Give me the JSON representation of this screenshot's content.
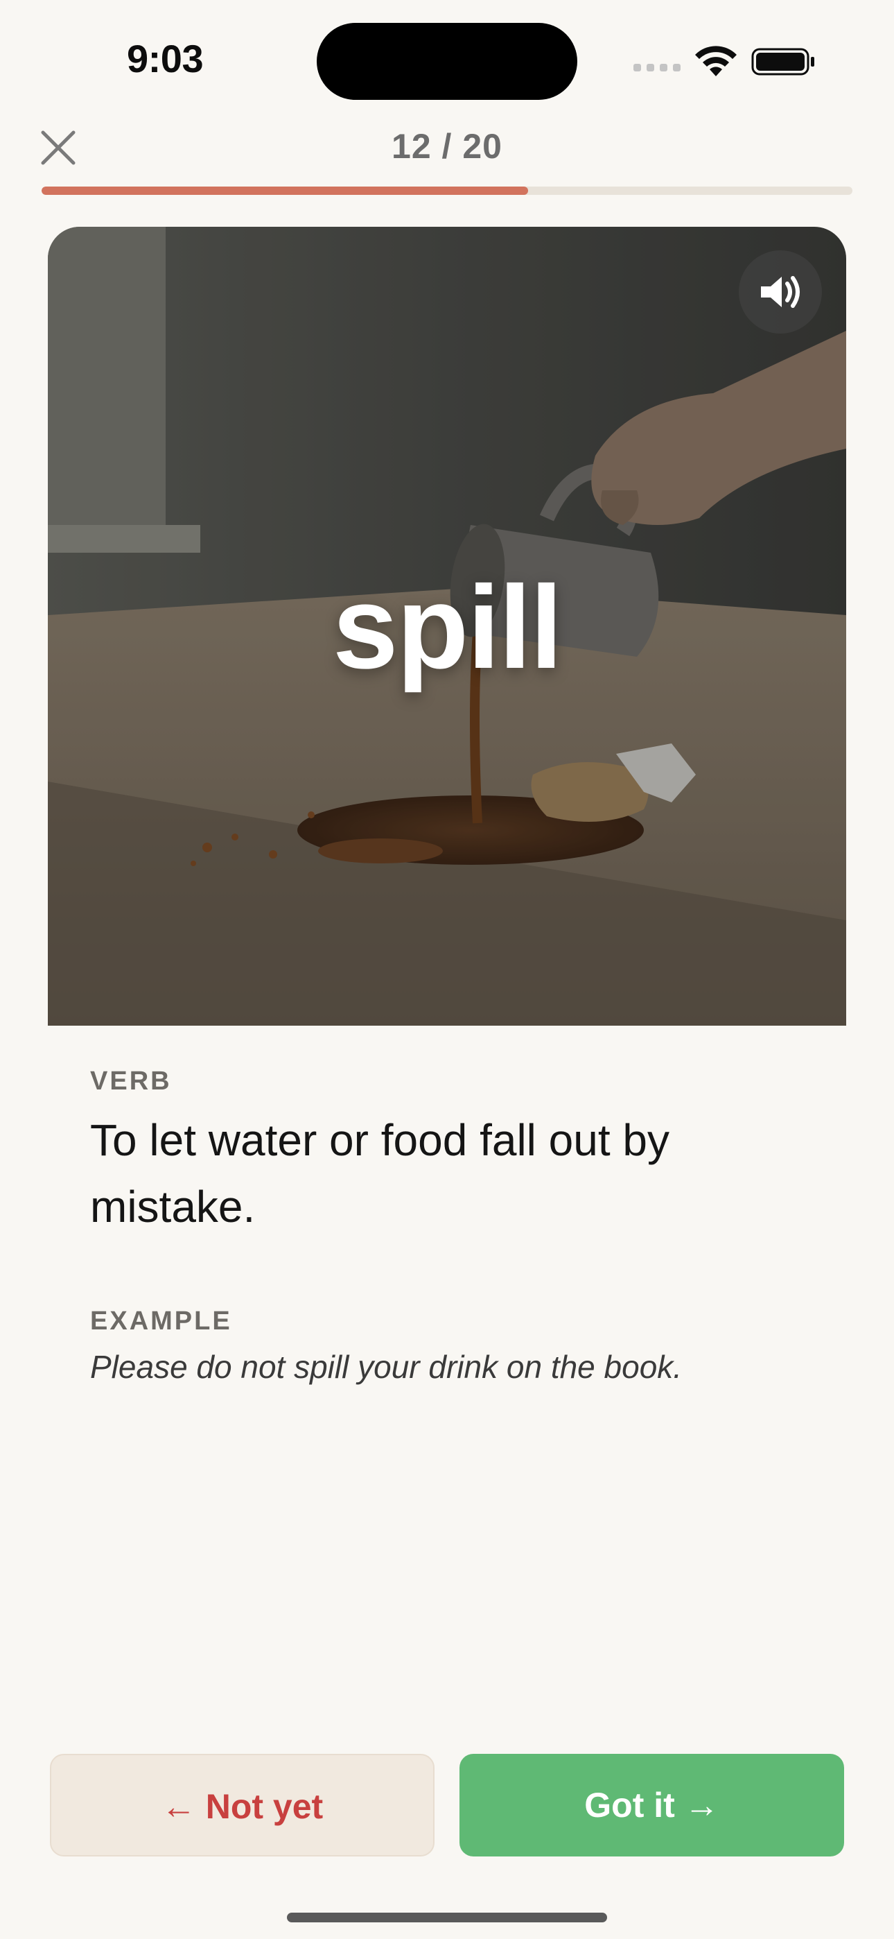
{
  "status_bar": {
    "time": "9:03"
  },
  "header": {
    "counter": "12 / 20",
    "progress_fraction": 0.6,
    "close_icon": "close-icon"
  },
  "card": {
    "word": "spill",
    "image_description_icon": "spill-illustration",
    "audio_icon": "speaker-icon"
  },
  "definition": {
    "part_of_speech": "VERB",
    "text": "To let water or food fall out by mistake."
  },
  "example": {
    "label": "EXAMPLE",
    "sentence": "Please do not spill your drink on the book."
  },
  "actions": {
    "not_yet_label": "← Not yet",
    "got_it_label": "Got it →"
  },
  "colors": {
    "accent": "#d2735d",
    "success": "#5fb974",
    "danger_text": "#c8403f",
    "background": "#f9f7f3"
  }
}
